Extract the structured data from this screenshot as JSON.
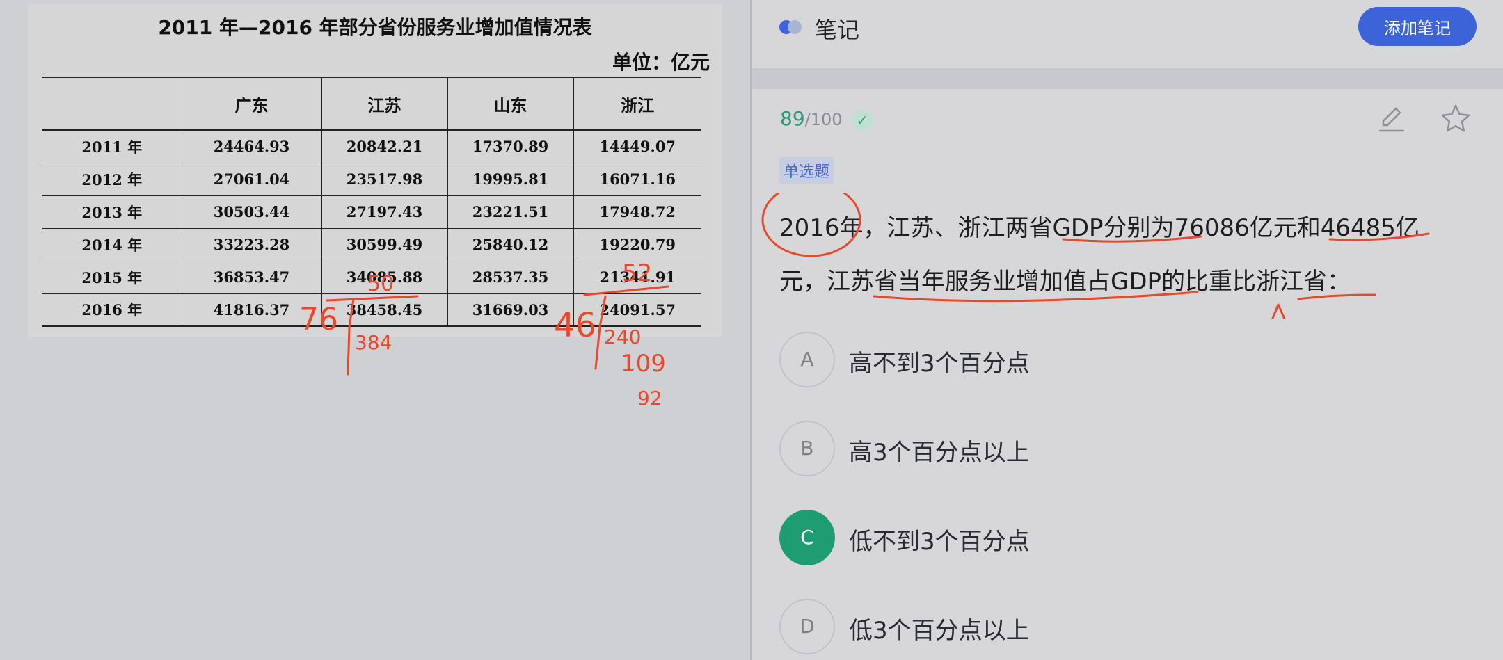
{
  "document": {
    "title": "2011 年—2016 年部分省份服务业增加值情况表",
    "unit": "单位：亿元",
    "columns": [
      "",
      "广东",
      "江苏",
      "山东",
      "浙江"
    ],
    "rows": [
      [
        "2011 年",
        "24464.93",
        "20842.21",
        "17370.89",
        "14449.07"
      ],
      [
        "2012 年",
        "27061.04",
        "23517.98",
        "19995.81",
        "16071.16"
      ],
      [
        "2013 年",
        "30503.44",
        "27197.43",
        "23221.51",
        "17948.72"
      ],
      [
        "2014 年",
        "33223.28",
        "30599.49",
        "25840.12",
        "19220.79"
      ],
      [
        "2015 年",
        "36853.47",
        "34085.88",
        "28537.35",
        "21341.91"
      ],
      [
        "2016 年",
        "41816.37",
        "38458.45",
        "31669.03",
        "24091.57"
      ]
    ]
  },
  "handwriting": {
    "note_76": "76",
    "note_50": "50",
    "note_384": "384",
    "note_46": "46",
    "note_52": "52",
    "note_240": "240",
    "note_109": "109",
    "note_92": "92"
  },
  "notes_panel": {
    "title": "笔记",
    "add_note_label": "添加笔记"
  },
  "question": {
    "score": "89",
    "score_total": "/100",
    "type_tag": "单选题",
    "stem": "2016年，江苏、浙江两省GDP分别为76086亿元和46485亿元，江苏省当年服务业增加值占GDP的比重比浙江省：",
    "options": [
      {
        "letter": "A",
        "text": "高不到3个百分点"
      },
      {
        "letter": "B",
        "text": "高3个百分点以上"
      },
      {
        "letter": "C",
        "text": "低不到3个百分点"
      },
      {
        "letter": "D",
        "text": "低3个百分点以上"
      }
    ],
    "selected": "C"
  },
  "colors": {
    "accent_blue": "#3c63d8",
    "selected_green": "#1e9d73",
    "ink_red": "#e8492c"
  }
}
